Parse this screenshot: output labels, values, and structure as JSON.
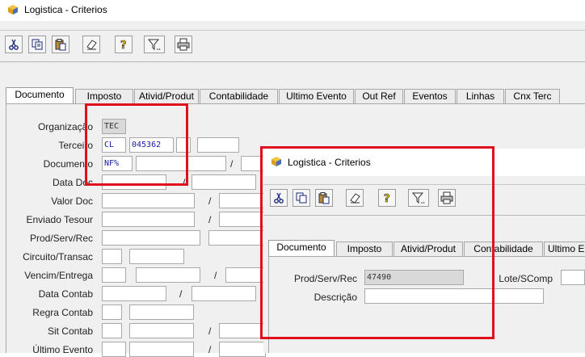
{
  "main_window": {
    "title": "Logistica - Criterios",
    "tabs": [
      "Documento",
      "Imposto",
      "Ativid/Produt",
      "Contabilidade",
      "Ultimo Evento",
      "Out Ref",
      "Eventos",
      "Linhas",
      "Cnx Terc"
    ],
    "active_tab": "Documento",
    "fields": {
      "organizacao": {
        "label": "Organização",
        "value": "TEC"
      },
      "terceiro": {
        "label": "Terceiro",
        "value1": "CL",
        "value2": "045362"
      },
      "documento": {
        "label": "Documento",
        "value": "NF%"
      },
      "data_doc": {
        "label": "Data Doc"
      },
      "valor_doc": {
        "label": "Valor Doc"
      },
      "enviado_tesour": {
        "label": "Enviado Tesour"
      },
      "prod_serv_rec": {
        "label": "Prod/Serv/Rec"
      },
      "circuito_transac": {
        "label": "Circuito/Transac"
      },
      "vencim_entrega": {
        "label": "Vencim/Entrega"
      },
      "data_contab": {
        "label": "Data Contab"
      },
      "regra_contab": {
        "label": "Regra Contab"
      },
      "sit_contab": {
        "label": "Sit Contab"
      },
      "ultimo_evento": {
        "label": "Último Evento"
      }
    },
    "slash": "/"
  },
  "toolbar_icons": [
    "cut-icon",
    "copy-icon",
    "paste-icon",
    "eraser-icon",
    "help-icon",
    "filter-icon",
    "print-icon"
  ],
  "overlay_window": {
    "title": "Logistica - Criterios",
    "tabs": [
      "Documento",
      "Imposto",
      "Ativid/Produt",
      "Contabilidade",
      "Ultimo E"
    ],
    "fields": {
      "prod_serv_rec": {
        "label": "Prod/Serv/Rec",
        "value": "47490"
      },
      "descricao": {
        "label": "Descrição",
        "value": ""
      },
      "lote_scomp": {
        "label": "Lote/SComp"
      }
    }
  },
  "colors": {
    "highlight": "#e0101e",
    "field_text": "#1a1aa6"
  }
}
